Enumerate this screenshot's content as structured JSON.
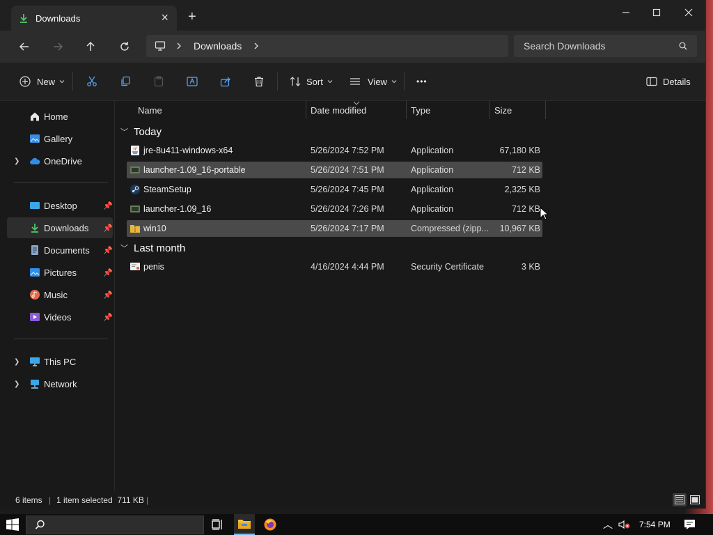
{
  "window": {
    "tab_title": "Downloads",
    "tab_close": "×",
    "new_tab": "+"
  },
  "address": {
    "location": "Downloads",
    "search_placeholder": "Search Downloads"
  },
  "commands": {
    "new": "New",
    "sort": "Sort",
    "view": "View",
    "more": "•••",
    "details": "Details"
  },
  "sidebar": {
    "items": [
      {
        "label": "Home"
      },
      {
        "label": "Gallery"
      },
      {
        "label": "OneDrive"
      },
      {
        "label": "Desktop"
      },
      {
        "label": "Downloads"
      },
      {
        "label": "Documents"
      },
      {
        "label": "Pictures"
      },
      {
        "label": "Music"
      },
      {
        "label": "Videos"
      },
      {
        "label": "This PC"
      },
      {
        "label": "Network"
      }
    ]
  },
  "columns": {
    "name": "Name",
    "date": "Date modified",
    "type": "Type",
    "size": "Size"
  },
  "groups": {
    "today": "Today",
    "last_month": "Last month"
  },
  "files": [
    {
      "name": "jre-8u411-windows-x64",
      "date": "5/26/2024 7:52 PM",
      "type": "Application",
      "size": "67,180 KB"
    },
    {
      "name": "launcher-1.09_16-portable",
      "date": "5/26/2024 7:51 PM",
      "type": "Application",
      "size": "712 KB"
    },
    {
      "name": "SteamSetup",
      "date": "5/26/2024 7:45 PM",
      "type": "Application",
      "size": "2,325 KB"
    },
    {
      "name": "launcher-1.09_16",
      "date": "5/26/2024 7:26 PM",
      "type": "Application",
      "size": "712 KB"
    },
    {
      "name": "win10",
      "date": "5/26/2024 7:17 PM",
      "type": "Compressed (zipp...",
      "size": "10,967 KB"
    },
    {
      "name": "penis",
      "date": "4/16/2024 4:44 PM",
      "type": "Security Certificate",
      "size": "3 KB"
    }
  ],
  "status": {
    "count": "6 items",
    "selection": "1 item selected  711 KB"
  },
  "taskbar": {
    "time": "7:54 PM"
  },
  "colors": {
    "selected_row": "#4a4a4a",
    "accent": "#4cc2ff",
    "window_bg": "#191919"
  }
}
